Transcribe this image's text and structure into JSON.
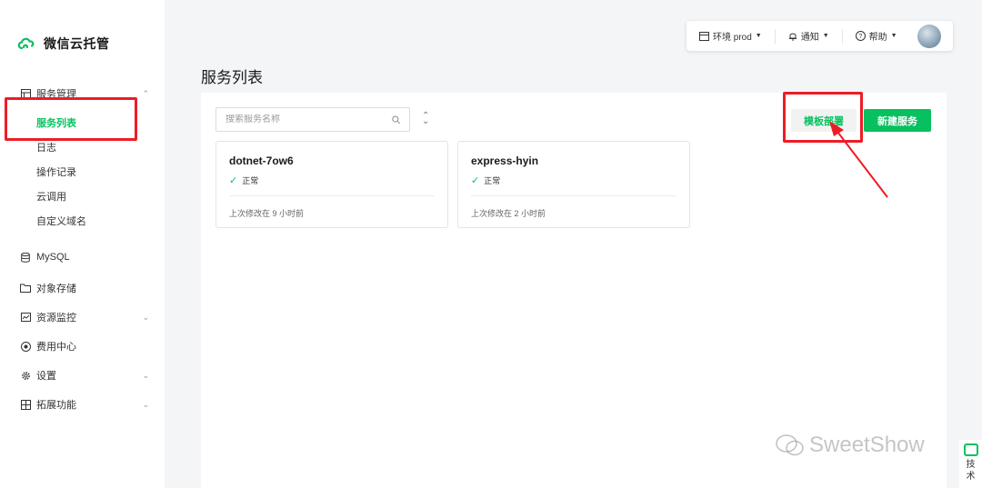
{
  "app": {
    "title": "微信云托管"
  },
  "sidebar": {
    "groups": [
      {
        "label": "服务管理",
        "icon": "service-list-icon",
        "expanded": true,
        "items": [
          {
            "label": "服务列表",
            "active": true
          },
          {
            "label": "日志"
          },
          {
            "label": "操作记录"
          },
          {
            "label": "云调用"
          },
          {
            "label": "自定义域名"
          }
        ]
      }
    ],
    "items": [
      {
        "label": "MySQL",
        "icon": "database-icon"
      },
      {
        "label": "对象存储",
        "icon": "folder-icon"
      },
      {
        "label": "资源监控",
        "icon": "monitor-chart-icon",
        "has_children": true
      },
      {
        "label": "费用中心",
        "icon": "billing-icon"
      },
      {
        "label": "设置",
        "icon": "gear-icon",
        "has_children": true
      },
      {
        "label": "拓展功能",
        "icon": "grid-icon",
        "has_children": true
      }
    ]
  },
  "topbar": {
    "env_label": "环境 prod",
    "notify_label": "通知",
    "help_label": "帮助"
  },
  "page": {
    "title": "服务列表"
  },
  "toolbar": {
    "search_placeholder": "搜索服务名称",
    "template_deploy_label": "模板部署",
    "new_service_label": "新建服务"
  },
  "services": [
    {
      "name": "dotnet-7ow6",
      "status": "正常",
      "modified": "上次修改在 9 小时前"
    },
    {
      "name": "express-hyin",
      "status": "正常",
      "modified": "上次修改在 2 小时前"
    }
  ],
  "watermark": {
    "text": "SweetShow"
  },
  "side_tool": {
    "chars": [
      "技",
      "术"
    ]
  },
  "colors": {
    "brand": "#07c160",
    "annotation": "#ee1c25"
  }
}
